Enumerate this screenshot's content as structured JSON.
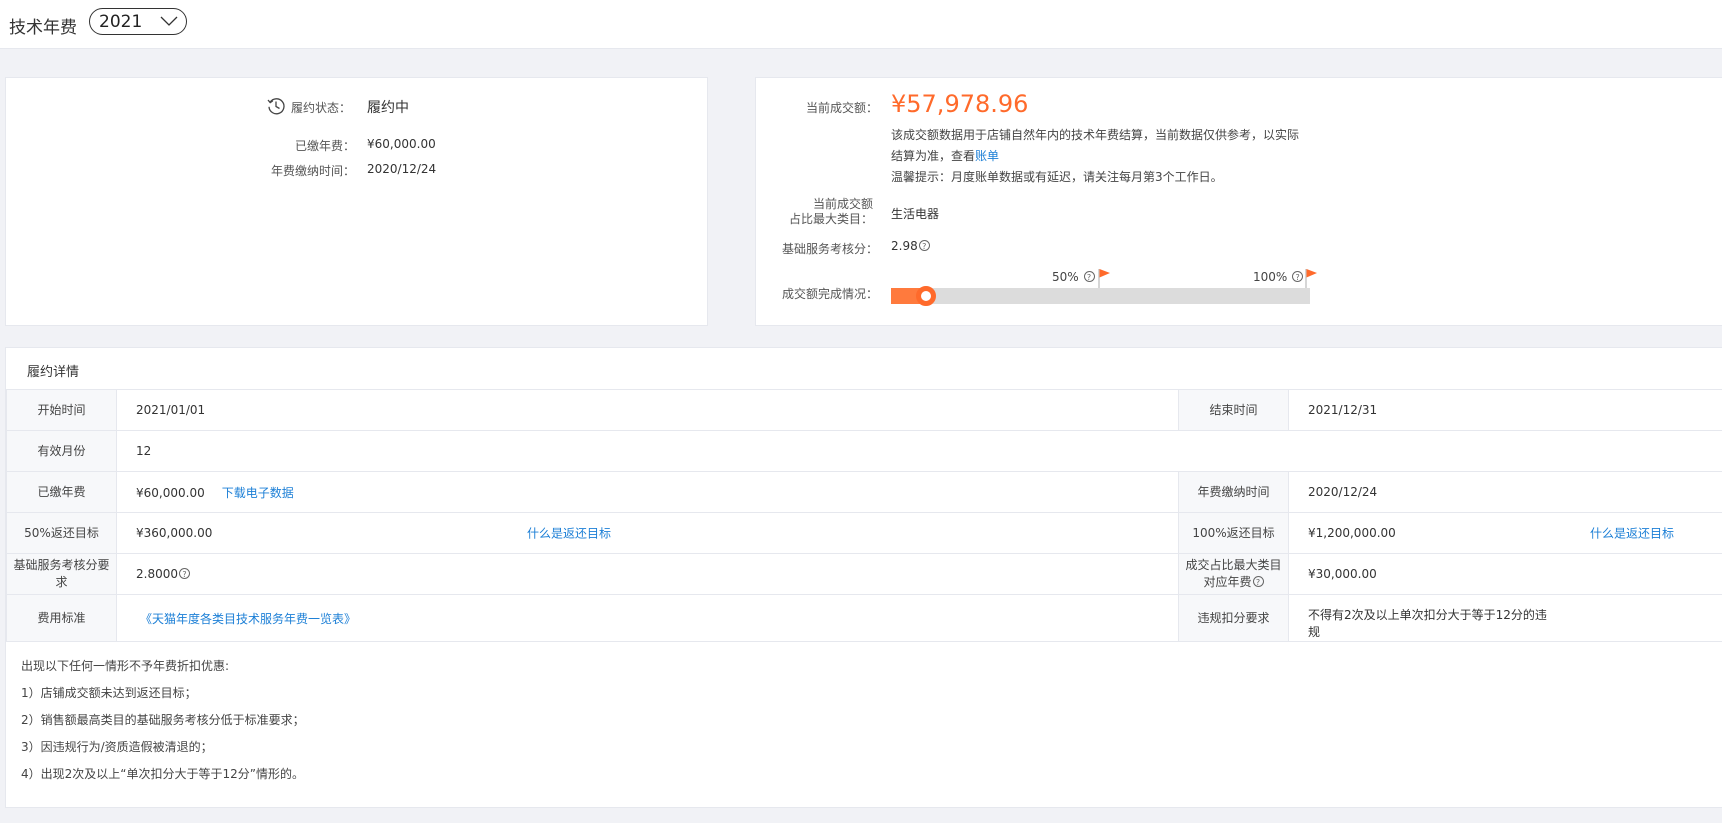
{
  "header": {
    "title": "技术年费",
    "year_select": {
      "value": "2021"
    }
  },
  "left_card": {
    "status_label": "履约状态：",
    "status_value": "履约中",
    "paid_fee_label": "已缴年费：",
    "paid_fee_value": "¥60,000.00",
    "pay_time_label": "年费缴纳时间：",
    "pay_time_value": "2020/12/24"
  },
  "right_card": {
    "current_amount_label": "当前成交额：",
    "current_amount_value": "¥57,978.96",
    "note_line1": "该成交额数据用于店铺自然年内的技术年费结算，当前数据仅供参考，以实际",
    "note_line2_prefix": "结算为准，查看",
    "note_link": "账单",
    "note_line3": "温馨提示：月度账单数据或有延迟，请关注每月第3个工作日。",
    "max_cat_label_line1": "当前成交额",
    "max_cat_label_line2": "占比最大类目：",
    "max_cat_value": "生活电器",
    "service_score_label": "基础服务考核分：",
    "service_score_value": "2.98",
    "progress_label": "成交额完成情况：",
    "marker_50": "50%",
    "marker_100": "100%",
    "progress_fraction": 0.083
  },
  "detail": {
    "title": "履约详情",
    "start_label": "开始时间",
    "start_value": "2021/01/01",
    "end_label": "结束时间",
    "end_value": "2021/12/31",
    "months_label": "有效月份",
    "months_value": "12",
    "paid_label": "已缴年费",
    "paid_value": "¥60,000.00",
    "download_link": "下载电子数据",
    "pay_time_label": "年费缴纳时间",
    "pay_time_value": "2020/12/24",
    "target50_label": "50%返还目标",
    "target50_value": "¥360,000.00",
    "what_target_link": "什么是返还目标",
    "target100_label": "100%返还目标",
    "target100_value": "¥1,200,000.00",
    "score_req_label_line1": "基础服务考核分要",
    "score_req_label_line2": "求",
    "score_req_value": "2.8000",
    "max_cat_fee_label_line1": "成交占比最大类目",
    "max_cat_fee_label_line2": "对应年费",
    "max_cat_fee_value": "¥30,000.00",
    "fee_std_label": "费用标准",
    "fee_std_link": "《天猫年度各类目技术服务年费一览表》",
    "violation_label": "违规扣分要求",
    "violation_value_line1": "不得有2次及以上单次扣分大于等于12分的违",
    "violation_value_line2": "规"
  },
  "rules": {
    "intro": "出现以下任何一情形不予年费折扣优惠:",
    "items": [
      "1）店铺成交额未达到返还目标；",
      "2）销售额最高类目的基础服务考核分低于标准要求；",
      "3）因违规行为/资质造假被清退的；",
      "4）出现2次及以上“单次扣分大于等于12分”情形的。"
    ]
  },
  "colors": {
    "accent": "#ff6a2b",
    "link": "#1c7fd6"
  },
  "icons": {
    "status": "history-clock-icon",
    "select": "chevron-down-icon",
    "help": "question-circle-icon",
    "flag": "flag-icon"
  }
}
